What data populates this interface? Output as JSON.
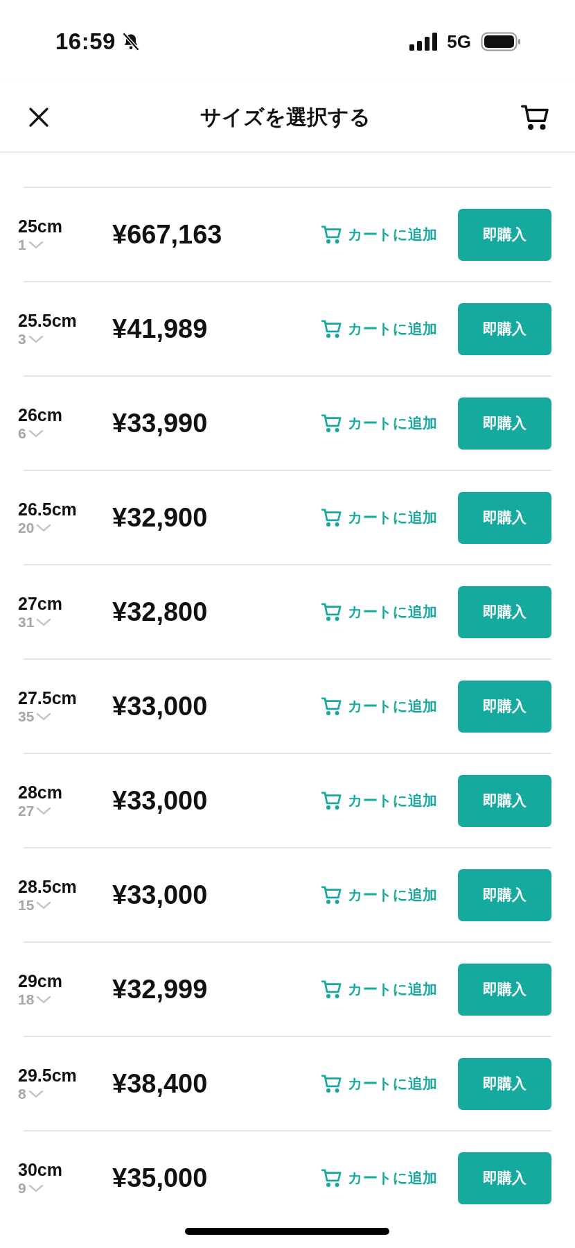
{
  "status_bar": {
    "time": "16:59",
    "network": "5G"
  },
  "header": {
    "title": "サイズを選択する"
  },
  "sizes": [
    {
      "size": "25cm",
      "count": "1",
      "price": "¥667,163",
      "cart_label": "カートに追加",
      "buy_label": "即購入"
    },
    {
      "size": "25.5cm",
      "count": "3",
      "price": "¥41,989",
      "cart_label": "カートに追加",
      "buy_label": "即購入"
    },
    {
      "size": "26cm",
      "count": "6",
      "price": "¥33,990",
      "cart_label": "カートに追加",
      "buy_label": "即購入"
    },
    {
      "size": "26.5cm",
      "count": "20",
      "price": "¥32,900",
      "cart_label": "カートに追加",
      "buy_label": "即購入"
    },
    {
      "size": "27cm",
      "count": "31",
      "price": "¥32,800",
      "cart_label": "カートに追加",
      "buy_label": "即購入"
    },
    {
      "size": "27.5cm",
      "count": "35",
      "price": "¥33,000",
      "cart_label": "カートに追加",
      "buy_label": "即購入"
    },
    {
      "size": "28cm",
      "count": "27",
      "price": "¥33,000",
      "cart_label": "カートに追加",
      "buy_label": "即購入"
    },
    {
      "size": "28.5cm",
      "count": "15",
      "price": "¥33,000",
      "cart_label": "カートに追加",
      "buy_label": "即購入"
    },
    {
      "size": "29cm",
      "count": "18",
      "price": "¥32,999",
      "cart_label": "カートに追加",
      "buy_label": "即購入"
    },
    {
      "size": "29.5cm",
      "count": "8",
      "price": "¥38,400",
      "cart_label": "カートに追加",
      "buy_label": "即購入"
    },
    {
      "size": "30cm",
      "count": "9",
      "price": "¥35,000",
      "cart_label": "カートに追加",
      "buy_label": "即購入"
    }
  ]
}
